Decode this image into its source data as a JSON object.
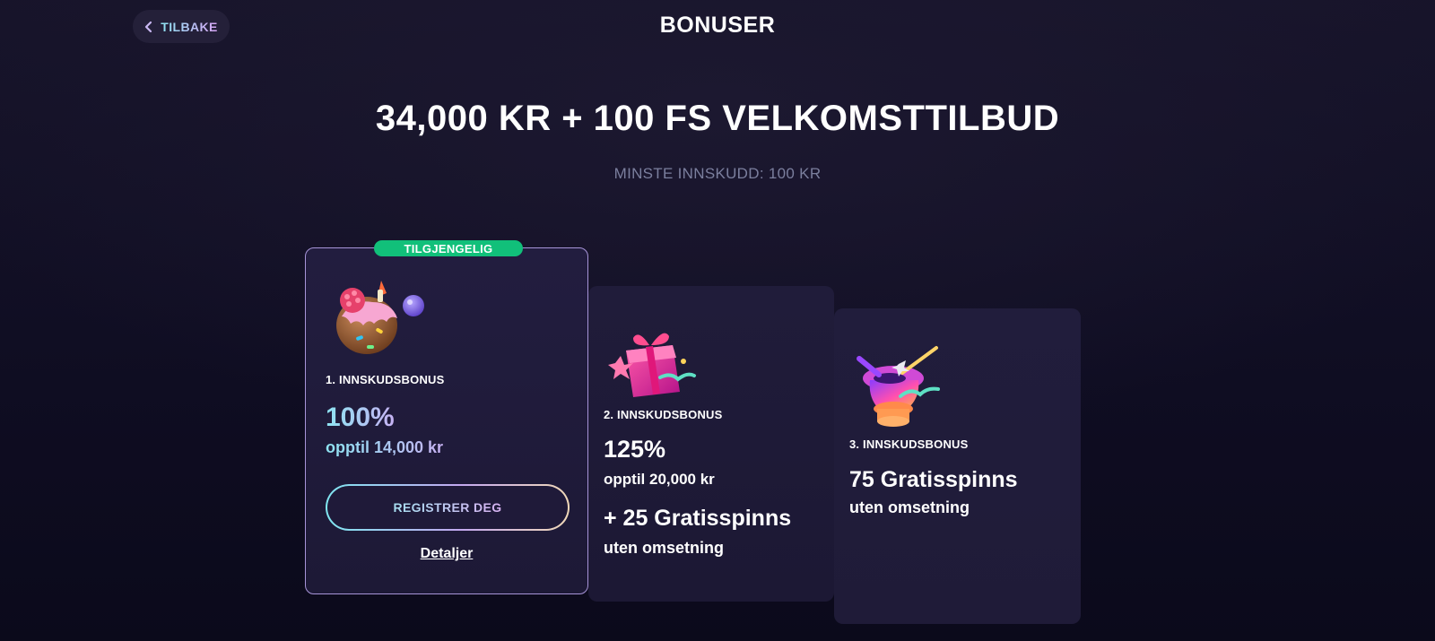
{
  "header": {
    "back_label": "TILBAKE",
    "title": "BONUSER"
  },
  "hero": {
    "title": "34,000 KR + 100 FS VELKOMSTTILBUD",
    "subtitle": "MINSTE INNSKUDD: 100 KR"
  },
  "cards": [
    {
      "badge": "TILGJENGELIG",
      "icon": "cake-icon",
      "label": "1. INNSKUDSBONUS",
      "percent": "100%",
      "upto": "opptil 14,000 kr",
      "button": "REGISTRER DEG",
      "details": "Detaljer"
    },
    {
      "icon": "gift-icon",
      "label": "2. INNSKUDSBONUS",
      "percent": "125%",
      "upto": "opptil 20,000 kr",
      "extra": "+ 25 Gratisspinns",
      "extra_sub": "uten omsetning"
    },
    {
      "icon": "magic-hat-icon",
      "label": "3. INNSKUDSBONUS",
      "extra": "75 Gratisspinns",
      "extra_sub": "uten omsetning"
    }
  ],
  "colors": {
    "background": "#0d0b1e",
    "card": "#1f1b38",
    "available_badge": "#11c07a",
    "accent_cyan": "#8ee4f2",
    "accent_purple": "#c7b2f3",
    "muted_text": "#7b7f9e"
  }
}
